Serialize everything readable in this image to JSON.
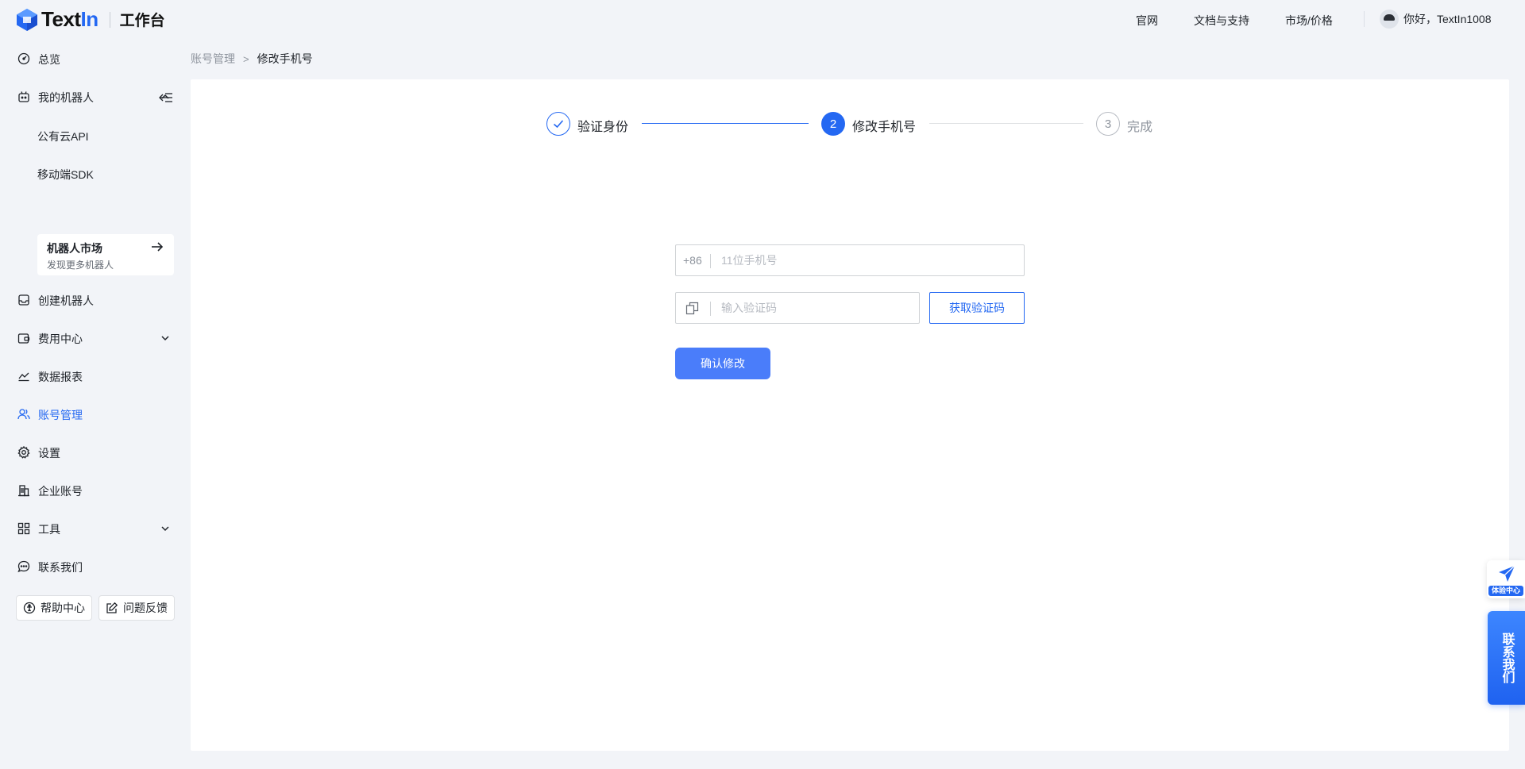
{
  "header": {
    "brand_prefix": "Text",
    "brand_suffix": "In",
    "workspace": "工作台",
    "nav": [
      "官网",
      "文档与支持",
      "市场/价格"
    ],
    "greeting": "你好，TextIn1008"
  },
  "sidebar": {
    "overview": "总览",
    "my_robots": "我的机器人",
    "public_api": "公有云API",
    "mobile_sdk": "移动端SDK",
    "market_title": "机器人市场",
    "market_sub": "发现更多机器人",
    "create_robot": "创建机器人",
    "billing": "费用中心",
    "reports": "数据报表",
    "account": "账号管理",
    "settings": "设置",
    "enterprise": "企业账号",
    "tools": "工具",
    "contact": "联系我们",
    "help_center": "帮助中心",
    "feedback": "问题反馈"
  },
  "breadcrumb": {
    "parent": "账号管理",
    "separator": ">",
    "current": "修改手机号"
  },
  "steps": [
    {
      "label": "验证身份",
      "state": "done"
    },
    {
      "number": "2",
      "label": "修改手机号",
      "state": "active"
    },
    {
      "number": "3",
      "label": "完成",
      "state": "pending"
    }
  ],
  "form": {
    "country_code": "+86",
    "phone_placeholder": "11位手机号",
    "code_placeholder": "输入验证码",
    "get_code": "获取验证码",
    "confirm": "确认修改"
  },
  "floating": {
    "experience": "体验中心",
    "contact": "联系我们"
  },
  "colors": {
    "primary": "#2468f2",
    "confirm_button": "#4a7dfa",
    "background": "#f2f4f8"
  }
}
